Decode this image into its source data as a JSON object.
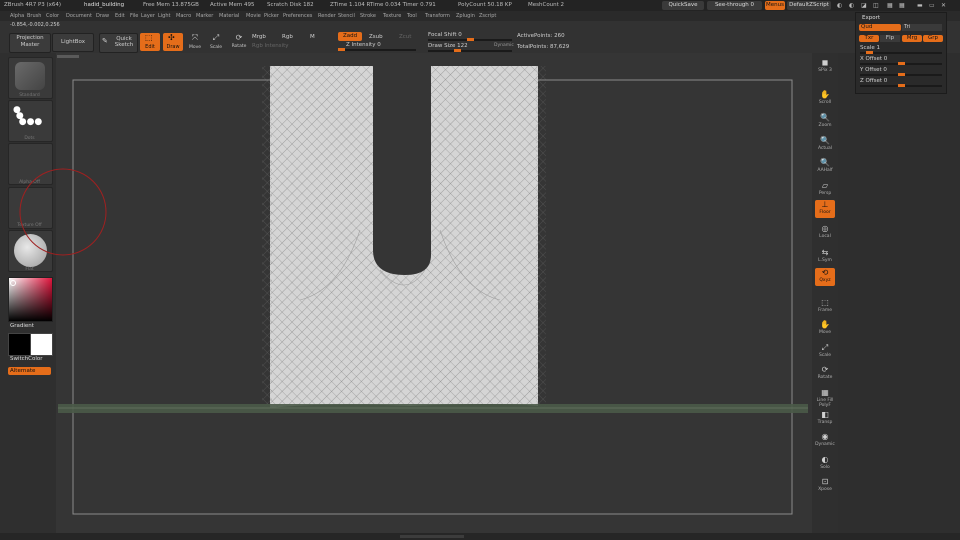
{
  "titlebar": {
    "app": "ZBrush 4R7 P3 (x64)",
    "document": "hadid_building",
    "free_mem": "Free Mem 13.875GB",
    "active_mem": "Active Mem 495",
    "scratch_disk": "Scratch Disk 182",
    "ztime": "ZTime 1.104 RTime 0.034 Timer 0.791",
    "polycount": "PolyCount 50.18 KP",
    "meshcount": "MeshCount 2",
    "quicksave": "QuickSave",
    "see_through": "See-through 0",
    "menus": "Menus",
    "default_script": "DefaultZScript"
  },
  "menu_items": [
    "Alpha",
    "Brush",
    "Color",
    "Document",
    "Draw",
    "Edit",
    "File",
    "Layer",
    "Light",
    "Macro",
    "Marker",
    "Material",
    "Movie",
    "Picker",
    "Preferences",
    "Render",
    "Stencil",
    "Stroke",
    "Texture",
    "Tool",
    "Transform",
    "Zplugin",
    "Zscript"
  ],
  "coords": "-0.854,-0.002,0.256",
  "toolbar": {
    "projection_master": "Projection Master",
    "lightbox": "LightBox",
    "quick_sketch": "Quick Sketch",
    "edit": "Edit",
    "draw": "Draw",
    "move": "Move",
    "scale": "Scale",
    "rotate": "Rotate",
    "mrgb": "Mrgb",
    "rgb": "Rgb",
    "m": "M",
    "rgb_intensity": "Rgb Intensity",
    "zadd": "Zadd",
    "zsub": "Zsub",
    "zcut": "Zcut",
    "z_intensity": "Z Intensity 0",
    "focal_shift": "Focal Shift 0",
    "draw_size": "Draw Size 122",
    "dynamic": "Dynamic",
    "active_points": "ActivePoints: 260",
    "total_points": "TotalPoints: 87,629"
  },
  "left_panel": {
    "brush_label": "Standard",
    "stroke_label": "Dots",
    "alpha_label": "Alpha Off",
    "texture_label": "Texture Off",
    "material_label": "Flat",
    "gradient": "Gradient",
    "switch_color": "SwitchColor",
    "alternate": "Alternate"
  },
  "right_bar": [
    {
      "label": "SPix 3",
      "icon": "spix-icon",
      "on": false
    },
    {
      "label": "Scroll",
      "icon": "scroll-icon",
      "on": false
    },
    {
      "label": "Zoom",
      "icon": "zoom-icon",
      "on": false
    },
    {
      "label": "Actual",
      "icon": "actual-icon",
      "on": false
    },
    {
      "label": "AAHalf",
      "icon": "aahalf-icon",
      "on": false
    },
    {
      "label": "Persp",
      "icon": "persp-icon",
      "on": false
    },
    {
      "label": "Floor",
      "icon": "floor-icon",
      "on": true
    },
    {
      "label": "Local",
      "icon": "local-icon",
      "on": false
    },
    {
      "label": "L.Sym",
      "icon": "lsym-icon",
      "on": false
    },
    {
      "label": "Qxyz",
      "icon": "xyz-icon",
      "on": true
    },
    {
      "label": "Frame",
      "icon": "frame-icon",
      "on": false
    },
    {
      "label": "Move",
      "icon": "move-icon",
      "on": false
    },
    {
      "label": "Scale",
      "icon": "scale-icon",
      "on": false
    },
    {
      "label": "Rotate",
      "icon": "rotate-icon",
      "on": false
    },
    {
      "label": "Line Fill PolyF",
      "icon": "polyframe-icon",
      "on": false
    },
    {
      "label": "Transp",
      "icon": "transp-icon",
      "on": false
    },
    {
      "label": "Dynamic",
      "icon": "dynamic-icon",
      "on": false
    },
    {
      "label": "Solo",
      "icon": "solo-icon",
      "on": false
    },
    {
      "label": "Xpose",
      "icon": "xpose-icon",
      "on": false
    }
  ],
  "export_panel": {
    "title": "Export",
    "qud": "Qud",
    "tri": "Tri",
    "txr": "Txr",
    "flp": "Flp",
    "mrg": "Mrg",
    "grp": "Grp",
    "scale": "Scale 1",
    "x_offset": "X Offset 0",
    "y_offset": "Y Offset 0",
    "z_offset": "Z Offset 0"
  },
  "colors": {
    "accent": "#e56d1a",
    "bg": "#2e2e2e",
    "viewport": "#353535",
    "mesh": "#d9d9d9",
    "floor": "#4a5a48"
  }
}
